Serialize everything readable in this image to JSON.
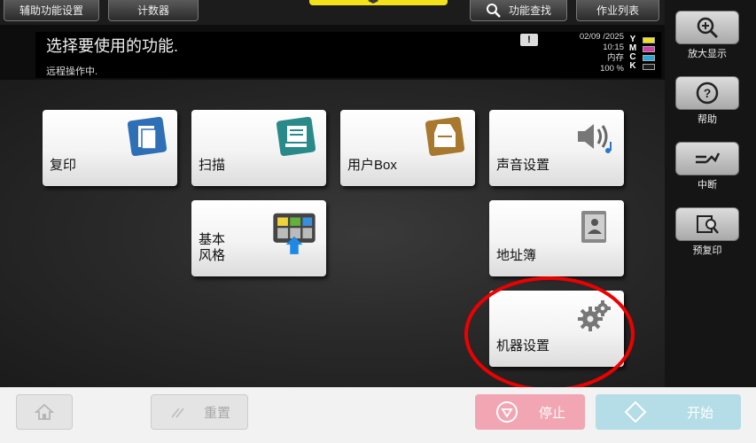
{
  "top": {
    "accessibility": "辅助功能设置",
    "counter": "计数器",
    "search": "功能查找",
    "joblist": "作业列表",
    "tab_mark": "◀▶"
  },
  "message": {
    "title": "选择要使用的功能.",
    "sub": "远程操作中.",
    "date": "02/09 /2025",
    "time": "10:15",
    "memory_label": "内存",
    "memory": "100 %"
  },
  "ymck": [
    "Y",
    "M",
    "C",
    "K"
  ],
  "colors": {
    "yellow": "#f2e21b",
    "magenta": "#d63ea7",
    "cyan": "#2aa6d9",
    "black": "#1c1c1c"
  },
  "tiles": [
    {
      "label": "复印",
      "icon": "copy-icon"
    },
    {
      "label": "扫描",
      "icon": "scan-icon"
    },
    {
      "label": "用户Box",
      "icon": "user-box-icon"
    },
    {
      "label": "声音设置",
      "icon": "sound-icon"
    },
    {
      "label": "基本风格",
      "line1": "基本",
      "line2": "风格",
      "icon": "basic-style-icon"
    },
    {
      "label": "地址簿",
      "icon": "address-book-icon"
    },
    {
      "label": "机器设置",
      "icon": "gear-icon"
    }
  ],
  "right": {
    "zoom": "放大显示",
    "help": "帮助",
    "interrupt": "中断",
    "preview": "预复印"
  },
  "bottom": {
    "reset": "重置",
    "stop": "停止",
    "start": "开始"
  }
}
